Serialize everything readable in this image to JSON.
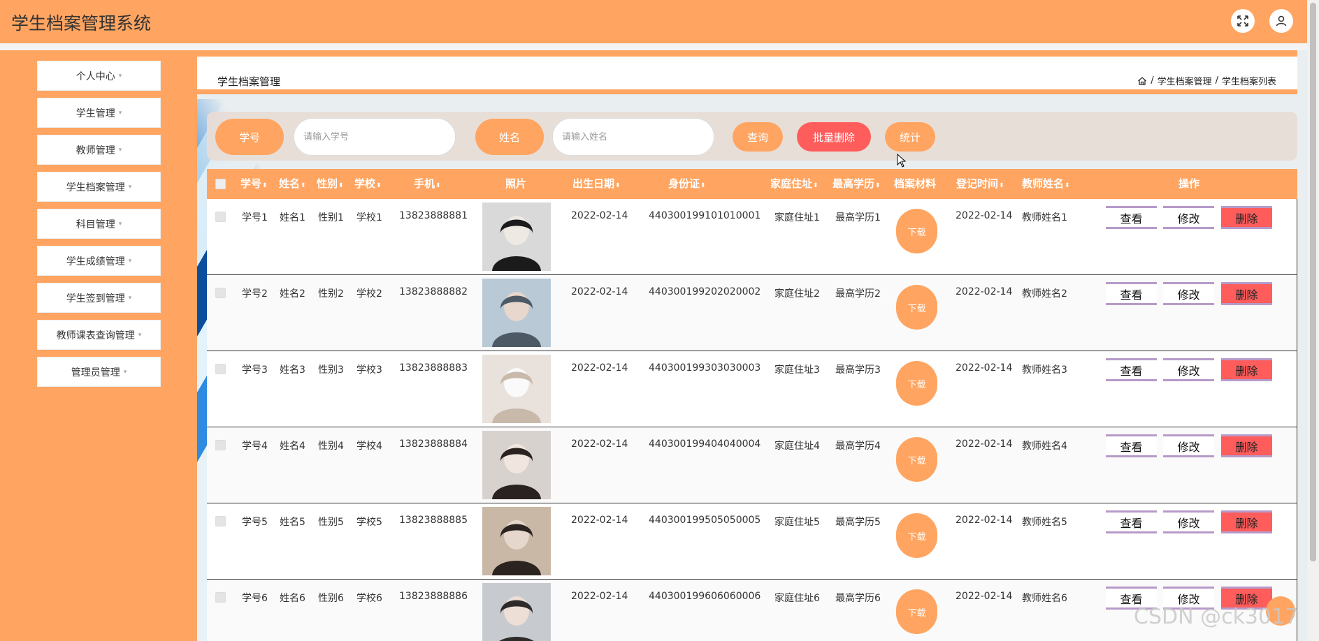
{
  "app": {
    "title": "学生档案管理系统"
  },
  "header": {
    "fullscreen_icon": "expand-icon",
    "user_icon": "user-icon"
  },
  "sidebar": {
    "items": [
      {
        "label": "个人中心"
      },
      {
        "label": "学生管理"
      },
      {
        "label": "教师管理"
      },
      {
        "label": "学生档案管理"
      },
      {
        "label": "科目管理"
      },
      {
        "label": "学生成绩管理"
      },
      {
        "label": "学生签到管理"
      },
      {
        "label": "教师课表查询管理"
      },
      {
        "label": "管理员管理"
      }
    ],
    "caret": "▾"
  },
  "page": {
    "title": "学生档案管理",
    "breadcrumb": [
      "学生档案管理",
      "学生档案列表"
    ],
    "separator": "/"
  },
  "search": {
    "id_label": "学号",
    "id_placeholder": "请输入学号",
    "name_label": "姓名",
    "name_placeholder": "请输入姓名",
    "query_btn": "查询",
    "batch_delete_btn": "批量删除",
    "stats_btn": "统计"
  },
  "table": {
    "sort_glyph": "⬍",
    "columns": [
      "学号",
      "姓名",
      "性别",
      "学校",
      "手机",
      "照片",
      "出生日期",
      "身份证",
      "家庭住址",
      "最高学历",
      "档案材料",
      "登记时间",
      "教师姓名",
      "操作"
    ],
    "rows": [
      {
        "id": "学号1",
        "name": "姓名1",
        "gender": "性别1",
        "school": "学校1",
        "phone": "13823888881",
        "birth": "2022-02-14",
        "idcard": "440300199101010001",
        "address": "家庭住址1",
        "education": "最高学历1",
        "regtime": "2022-02-14",
        "teacher": "教师姓名1"
      },
      {
        "id": "学号2",
        "name": "姓名2",
        "gender": "性别2",
        "school": "学校2",
        "phone": "13823888882",
        "birth": "2022-02-14",
        "idcard": "440300199202020002",
        "address": "家庭住址2",
        "education": "最高学历2",
        "regtime": "2022-02-14",
        "teacher": "教师姓名2"
      },
      {
        "id": "学号3",
        "name": "姓名3",
        "gender": "性别3",
        "school": "学校3",
        "phone": "13823888883",
        "birth": "2022-02-14",
        "idcard": "440300199303030003",
        "address": "家庭住址3",
        "education": "最高学历3",
        "regtime": "2022-02-14",
        "teacher": "教师姓名3"
      },
      {
        "id": "学号4",
        "name": "姓名4",
        "gender": "性别4",
        "school": "学校4",
        "phone": "13823888884",
        "birth": "2022-02-14",
        "idcard": "440300199404040004",
        "address": "家庭住址4",
        "education": "最高学历4",
        "regtime": "2022-02-14",
        "teacher": "教师姓名4"
      },
      {
        "id": "学号5",
        "name": "姓名5",
        "gender": "性别5",
        "school": "学校5",
        "phone": "13823888885",
        "birth": "2022-02-14",
        "idcard": "440300199505050005",
        "address": "家庭住址5",
        "education": "最高学历5",
        "regtime": "2022-02-14",
        "teacher": "教师姓名5"
      },
      {
        "id": "学号6",
        "name": "姓名6",
        "gender": "性别6",
        "school": "学校6",
        "phone": "13823888886",
        "birth": "2022-02-14",
        "idcard": "440300199606060006",
        "address": "家庭住址6",
        "education": "最高学历6",
        "regtime": "2022-02-14",
        "teacher": "教师姓名6"
      }
    ],
    "download_label": "下载",
    "actions": {
      "view": "查看",
      "edit": "修改",
      "delete": "删除"
    }
  },
  "watermark": "CSDN @ck3017",
  "colors": {
    "accent": "#ffa561",
    "danger": "#ff5c5c",
    "action_border": "#b79ac9"
  }
}
